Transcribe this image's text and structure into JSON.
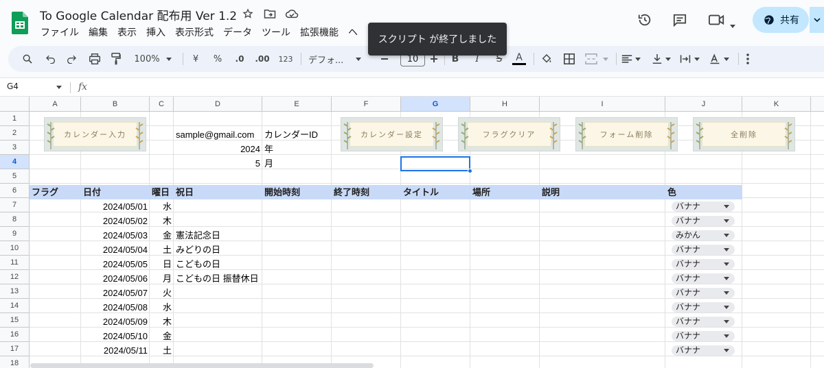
{
  "app": {
    "title": "To Google Calendar 配布用 Ver 1.2",
    "menu": [
      "ファイル",
      "編集",
      "表示",
      "挿入",
      "表示形式",
      "データ",
      "ツール",
      "拡張機能",
      "ヘ"
    ],
    "share_label": "共有"
  },
  "toast": "スクリプト が終了しました",
  "toolbar": {
    "zoom": "100%",
    "currency": "¥",
    "percent": "%",
    "dec_decrease": ".0",
    "dec_increase": ".00",
    "number_format": "123",
    "font": "デフォ...",
    "font_size": "10",
    "bold": "B",
    "italic": "I",
    "strike": "S",
    "text_color": "A"
  },
  "formula_bar": {
    "cell_ref": "G4",
    "fx": "fx",
    "value": ""
  },
  "columns": [
    "A",
    "B",
    "C",
    "D",
    "E",
    "F",
    "G",
    "H",
    "I",
    "J",
    "K"
  ],
  "selected_column": "G",
  "rows": [
    "1",
    "2",
    "3",
    "4",
    "5",
    "6",
    "7",
    "8",
    "9",
    "10",
    "11",
    "12",
    "13",
    "14",
    "15",
    "16",
    "17",
    "18"
  ],
  "selected_row": "4",
  "settings": {
    "email": "sample@gmail.com",
    "calendar_id_label": "カレンダーID",
    "year": "2024",
    "year_label": "年",
    "month": "5",
    "month_label": "月"
  },
  "buttons": [
    "カレンダー入力",
    "カレンダー設定",
    "フラグクリア",
    "フォーム削除",
    "全削除"
  ],
  "table_headers": [
    "フラグ",
    "日付",
    "曜日",
    "祝日",
    "開始時刻",
    "終了時刻",
    "タイトル",
    "場所",
    "説明",
    "色"
  ],
  "table_rows": [
    {
      "date": "2024/05/01",
      "dow": "水",
      "holiday": "",
      "color": "バナナ"
    },
    {
      "date": "2024/05/02",
      "dow": "木",
      "holiday": "",
      "color": "バナナ"
    },
    {
      "date": "2024/05/03",
      "dow": "金",
      "holiday": "憲法記念日",
      "color": "みかん"
    },
    {
      "date": "2024/05/04",
      "dow": "土",
      "holiday": "みどりの日",
      "color": "バナナ"
    },
    {
      "date": "2024/05/05",
      "dow": "日",
      "holiday": "こどもの日",
      "color": "バナナ"
    },
    {
      "date": "2024/05/06",
      "dow": "月",
      "holiday": "こどもの日 振替休日",
      "color": "バナナ"
    },
    {
      "date": "2024/05/07",
      "dow": "火",
      "holiday": "",
      "color": "バナナ"
    },
    {
      "date": "2024/05/08",
      "dow": "水",
      "holiday": "",
      "color": "バナナ"
    },
    {
      "date": "2024/05/09",
      "dow": "木",
      "holiday": "",
      "color": "バナナ"
    },
    {
      "date": "2024/05/10",
      "dow": "金",
      "holiday": "",
      "color": "バナナ"
    },
    {
      "date": "2024/05/11",
      "dow": "土",
      "holiday": "",
      "color": "バナナ"
    }
  ],
  "colors": {
    "accent": "#0b57d0",
    "header_band": "#c9daf8",
    "share_bg": "#c2e7ff",
    "sheets_green": "#0f9d58"
  }
}
